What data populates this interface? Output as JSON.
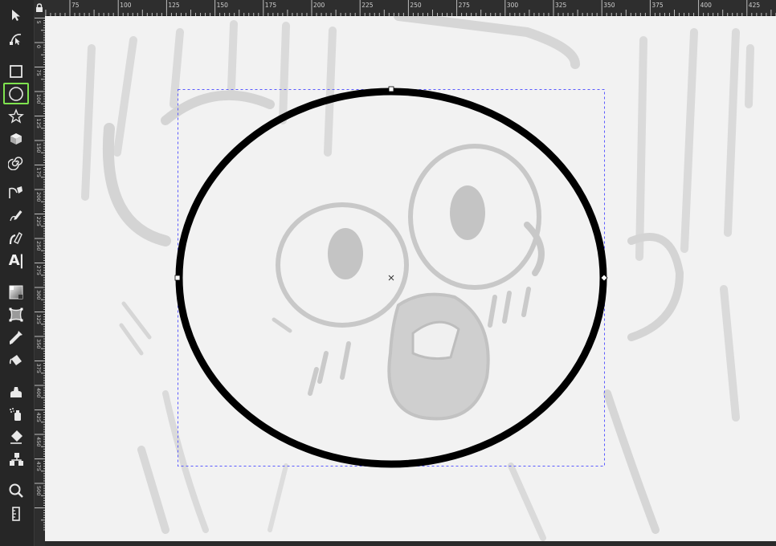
{
  "app": {
    "lock_glyph": "🔒"
  },
  "toolbox": {
    "tools": [
      {
        "id": "selector",
        "icon": "arrow-pointer-icon",
        "active": false
      },
      {
        "id": "node",
        "icon": "node-editor-icon",
        "active": false
      },
      {
        "id": "rectangle",
        "icon": "rectangle-icon",
        "active": false
      },
      {
        "id": "ellipse",
        "icon": "ellipse-icon",
        "active": true
      },
      {
        "id": "star",
        "icon": "star-icon",
        "active": false
      },
      {
        "id": "3dbox",
        "icon": "cube-icon",
        "active": false
      },
      {
        "id": "spiral",
        "icon": "spiral-icon",
        "active": false
      },
      {
        "id": "bezier",
        "icon": "bezier-pen-icon",
        "active": false
      },
      {
        "id": "pencil",
        "icon": "pencil-icon",
        "active": false
      },
      {
        "id": "calligraphy",
        "icon": "calligraphy-pen-icon",
        "active": false
      },
      {
        "id": "text",
        "icon": "text-tool-icon",
        "active": false,
        "label": "A|"
      },
      {
        "id": "gradient",
        "icon": "gradient-icon",
        "active": false
      },
      {
        "id": "mesh",
        "icon": "mesh-icon",
        "active": false
      },
      {
        "id": "dropper",
        "icon": "eyedropper-icon",
        "active": false
      },
      {
        "id": "paintbucket",
        "icon": "paint-bucket-icon",
        "active": false
      },
      {
        "id": "tweak",
        "icon": "tweak-icon",
        "active": false
      },
      {
        "id": "spray",
        "icon": "spray-icon",
        "active": false
      },
      {
        "id": "eraser",
        "icon": "eraser-icon",
        "active": false
      },
      {
        "id": "connector",
        "icon": "connector-icon",
        "active": false
      },
      {
        "id": "zoom",
        "icon": "zoom-icon",
        "active": false
      },
      {
        "id": "measure",
        "icon": "measure-icon",
        "active": false
      }
    ]
  },
  "rulers": {
    "horizontal_labels": [
      "75",
      "100",
      "125",
      "150",
      "175",
      "200",
      "225",
      "250",
      "275",
      "300",
      "325",
      "350",
      "375",
      "400",
      "425"
    ],
    "vertical_labels": [
      "0",
      "5",
      "0",
      "75",
      "100",
      "125",
      "150",
      "175",
      "200",
      "225",
      "250",
      "275",
      "300",
      "325",
      "350",
      "375",
      "400",
      "425",
      "450",
      "475",
      "500"
    ]
  },
  "selection": {
    "shape": "ellipse",
    "stroke_color": "#000000",
    "bbox_color": "#5a5aff"
  }
}
